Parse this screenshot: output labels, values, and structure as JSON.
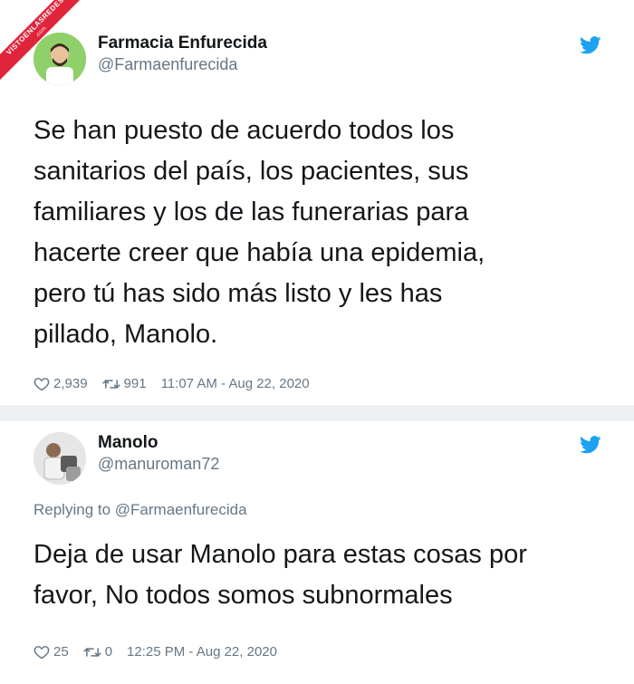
{
  "watermark": {
    "text": "VISTOENLASREDES",
    "sub": ".com"
  },
  "tweet1": {
    "display_name": "Farmacia Enfurecida",
    "handle": "@Farmaenfurecida",
    "text": "Se han puesto de acuerdo todos los\nsanitarios del país, los pacientes, sus\nfamiliares y los de las funerarias para\nhacerte creer que había una epidemia,\npero tú has sido más listo y les has\npillado, Manolo.",
    "likes": "2,939",
    "retweets": "991",
    "timestamp": "11:07 AM - Aug 22, 2020"
  },
  "tweet2": {
    "display_name": "Manolo",
    "handle": "@manuroman72",
    "replying_to": "Replying to @Farmaenfurecida",
    "text": "Deja de usar Manolo para estas cosas por\nfavor, No todos somos subnormales",
    "likes": "25",
    "retweets": "0",
    "timestamp": "12:25 PM - Aug 22, 2020"
  },
  "colors": {
    "twitter_blue": "#1da1f2",
    "muted": "#657786",
    "text": "#14171a",
    "watermark_red": "#e0243a"
  },
  "icons": [
    "twitter-bird-icon",
    "heart-icon",
    "retweet-icon"
  ]
}
